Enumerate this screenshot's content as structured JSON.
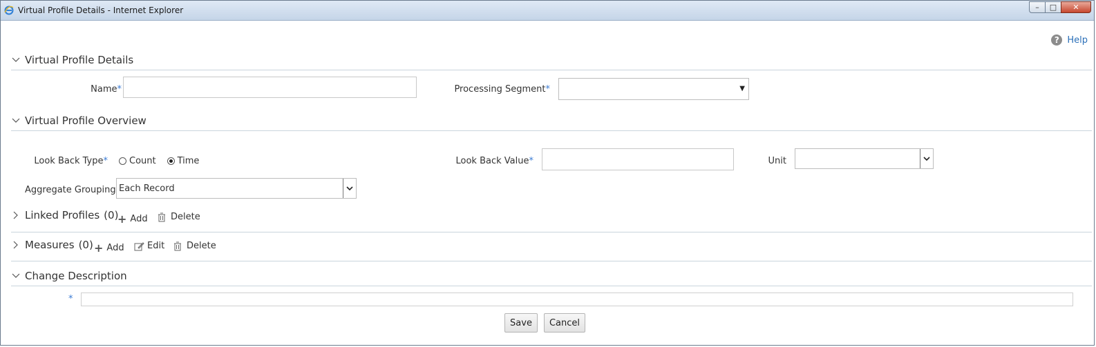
{
  "window": {
    "title": "Virtual Profile Details - Internet Explorer"
  },
  "help": {
    "label": "Help"
  },
  "sections": {
    "details": {
      "title": "Virtual Profile Details"
    },
    "overview": {
      "title": "Virtual Profile Overview"
    },
    "linked": {
      "title": "Linked Profiles",
      "count": "(0)"
    },
    "measures": {
      "title": "Measures",
      "count": "(0)"
    },
    "change": {
      "title": "Change Description"
    }
  },
  "fields": {
    "name": {
      "label": "Name",
      "value": ""
    },
    "processing_segment": {
      "label": "Processing Segment",
      "value": ""
    },
    "look_back_type": {
      "label": "Look Back Type",
      "options": [
        "Count",
        "Time"
      ],
      "selected": "Time"
    },
    "look_back_value": {
      "label": "Look Back Value",
      "value": ""
    },
    "unit": {
      "label": "Unit",
      "value": ""
    },
    "aggregate_grouping": {
      "label": "Aggregate Grouping",
      "value": "Each Record"
    },
    "change_description": {
      "value": ""
    }
  },
  "required_marker": "*",
  "toolbar": {
    "add": "Add",
    "edit": "Edit",
    "delete": "Delete"
  },
  "buttons": {
    "save": "Save",
    "cancel": "Cancel"
  },
  "colors": {
    "accent": "#3b7bd4",
    "link": "#2a6fb8",
    "close": "#c7472f"
  }
}
